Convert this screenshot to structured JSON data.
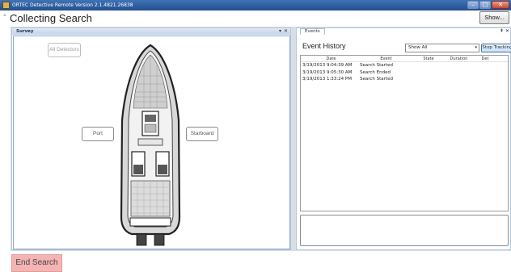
{
  "window": {
    "title": "ORTEC Detective Remote Version 2.1.4821.26838",
    "controls": [
      "–",
      "□",
      "✕"
    ]
  },
  "header": {
    "title": "Collecting Search",
    "show_button": "Show..."
  },
  "survey_panel": {
    "title": "Survey",
    "pin": "▾",
    "close": "✕",
    "buttons": {
      "all_detectors": "All Detectors",
      "port": "Port",
      "starboard": "Starboard"
    }
  },
  "events_panel": {
    "tab": "Events",
    "pin": "⇞",
    "close": "✕",
    "title": "Event History",
    "filter_value": "Show All",
    "filter_arrow": "▾",
    "stop_button": "Stop Tracking",
    "columns": [
      "Date",
      "Event",
      "State",
      "Duration",
      "Det"
    ],
    "rows": [
      {
        "date": "3/19/2013 9:04:39 AM",
        "event": "Search Started",
        "state": "",
        "duration": "",
        "det": ""
      },
      {
        "date": "3/19/2013 9:05:30 AM",
        "event": "Search Ended",
        "state": "",
        "duration": "",
        "det": ""
      },
      {
        "date": "3/19/2013 1:33:24 PM",
        "event": "Search Started",
        "state": "",
        "duration": "",
        "det": ""
      }
    ]
  },
  "footer": {
    "end_search": "End Search"
  },
  "colors": {
    "end_search_bg": "#f5b4b4",
    "titlebar": "#2c5a9c",
    "panel_border": "#b7c6da"
  }
}
